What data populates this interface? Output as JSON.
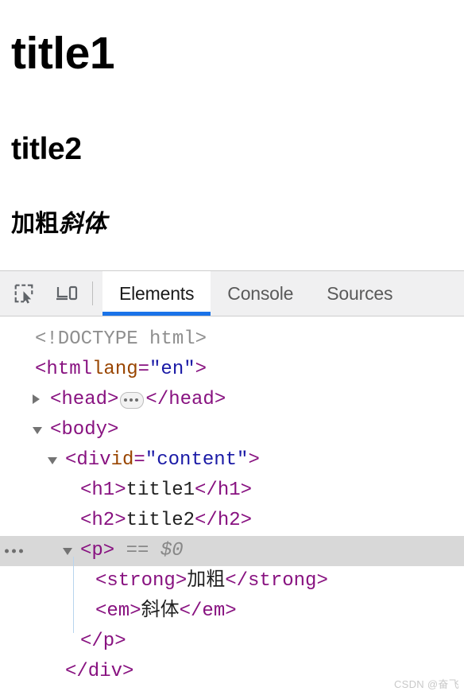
{
  "page_view": {
    "h1": "title1",
    "h2": "title2",
    "paragraph": {
      "strong": "加粗",
      "em": "斜体"
    }
  },
  "devtools": {
    "toolbar": {
      "inspect_icon": "inspect-element-picker-icon",
      "device_icon": "device-toolbar-icon",
      "tabs": [
        {
          "label": "Elements",
          "active": true
        },
        {
          "label": "Console",
          "active": false
        },
        {
          "label": "Sources",
          "active": false
        }
      ]
    },
    "accent_color": "#1a73e8",
    "selected_row_bg": "#d8d8d8",
    "colors": {
      "tag": "#881280",
      "attribute_name": "#994500",
      "attribute_value": "#1a1aa6",
      "doctype": "#8f8f8f",
      "text": "#222222"
    },
    "dom_tree": [
      {
        "id": "doctype",
        "indent": 1,
        "twisty": "none",
        "doctype": "<!DOCTYPE html>"
      },
      {
        "id": "html-open",
        "indent": 1,
        "twisty": "none",
        "open": "<html",
        "attr_name": " lang",
        "attr_eq": "=",
        "attr_value": "\"en\"",
        "close": ">"
      },
      {
        "id": "head",
        "indent": 2,
        "twisty": "collapsed",
        "open": "<head>",
        "collapsed_badge": "ellipsis-badge",
        "close": "</head>"
      },
      {
        "id": "body-open",
        "indent": 2,
        "twisty": "expanded",
        "open": "<body>"
      },
      {
        "id": "div-content-open",
        "indent": 3,
        "twisty": "expanded",
        "open": "<div",
        "attr_name": " id",
        "attr_eq": "=",
        "attr_value": "\"content\"",
        "close": ">"
      },
      {
        "id": "h1",
        "indent": 4,
        "twisty": "none",
        "open": "<h1>",
        "text": "title1",
        "close": "</h1>"
      },
      {
        "id": "h2",
        "indent": 4,
        "twisty": "none",
        "open": "<h2>",
        "text": "title2",
        "close": "</h2>"
      },
      {
        "id": "p-open",
        "indent": 4,
        "twisty": "expanded",
        "selected": true,
        "more_badge": "three-dots",
        "open": "<p>",
        "eq": "==",
        "console_ref": "$0"
      },
      {
        "id": "strong",
        "indent": 5,
        "twisty": "none",
        "open": "<strong>",
        "text": "加粗",
        "close": "</strong>"
      },
      {
        "id": "em",
        "indent": 5,
        "twisty": "none",
        "open": "<em>",
        "text": "斜体",
        "close": "</em>"
      },
      {
        "id": "p-close",
        "indent": 4,
        "twisty": "none",
        "open": "</p>"
      },
      {
        "id": "div-close",
        "indent": 3,
        "twisty": "none",
        "open": "</div>"
      }
    ]
  },
  "watermark": "CSDN @奋飞"
}
